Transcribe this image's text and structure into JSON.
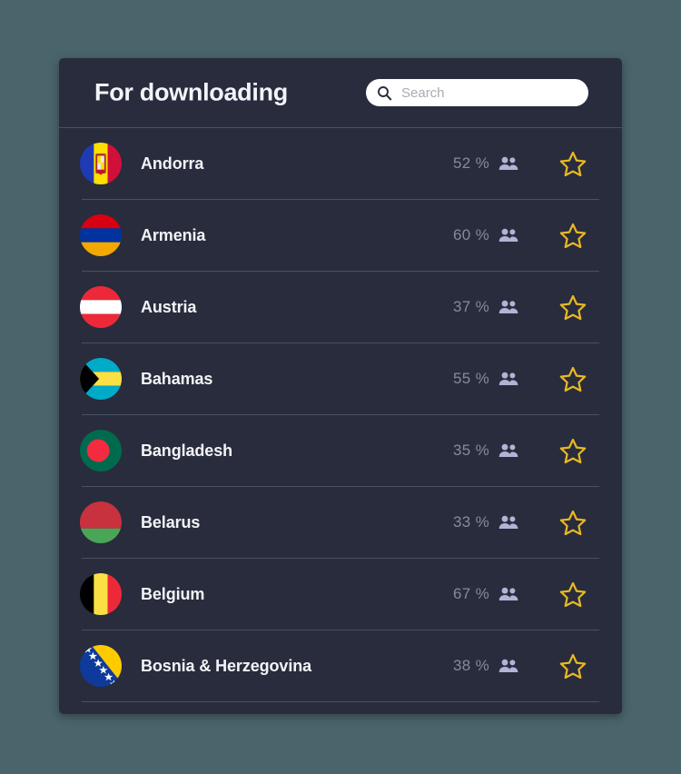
{
  "colors": {
    "page_background": "#4a646c",
    "card_background": "#282c3c",
    "divider": "#4b5163",
    "title_text": "#f2f4f8",
    "percent_text": "#868b9b",
    "people_icon": "#b0b4d6",
    "star_icon": "#e8b923",
    "search_background": "#ffffff",
    "search_placeholder": "#a9abb3"
  },
  "header": {
    "title": "For downloading",
    "search": {
      "placeholder": "Search",
      "value": "",
      "icon": "search-icon"
    }
  },
  "list": {
    "row_icons": {
      "people": "people-icon",
      "star": "star-outline-icon"
    },
    "rows": [
      {
        "country": "Andorra",
        "percent": "52 %",
        "flag": "flag-andorra"
      },
      {
        "country": "Armenia",
        "percent": "60 %",
        "flag": "flag-armenia"
      },
      {
        "country": "Austria",
        "percent": "37 %",
        "flag": "flag-austria"
      },
      {
        "country": "Bahamas",
        "percent": "55 %",
        "flag": "flag-bahamas"
      },
      {
        "country": "Bangladesh",
        "percent": "35 %",
        "flag": "flag-bangladesh"
      },
      {
        "country": "Belarus",
        "percent": "33 %",
        "flag": "flag-belarus"
      },
      {
        "country": "Belgium",
        "percent": "67 %",
        "flag": "flag-belgium"
      },
      {
        "country": "Bosnia & Herzegovina",
        "percent": "38 %",
        "flag": "flag-bosnia-herzegovina"
      }
    ]
  }
}
